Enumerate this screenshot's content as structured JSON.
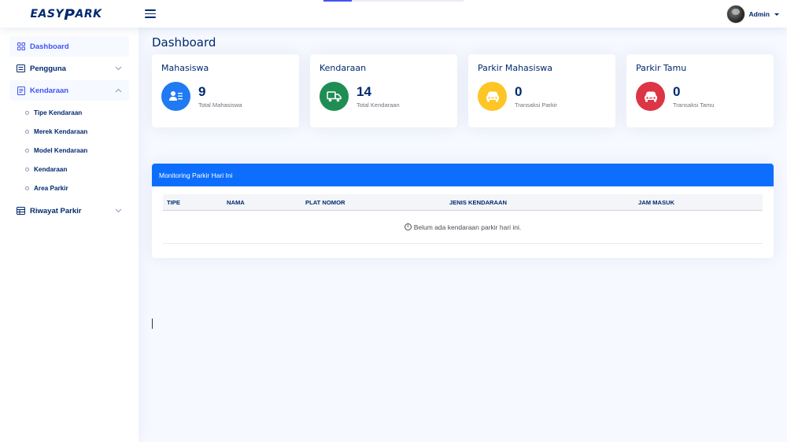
{
  "header": {
    "logo_left": "EASY ",
    "logo_p": "P",
    "logo_right": "ARK",
    "profile_name": "Admin"
  },
  "sidebar": {
    "items": [
      {
        "label": "Dashboard",
        "icon": "grid-icon",
        "state": "active"
      },
      {
        "label": "Pengguna",
        "icon": "menu-button-icon",
        "chevron": "chevron-down-icon"
      },
      {
        "label": "Kendaraan",
        "icon": "journal-icon",
        "chevron": "chevron-up-icon",
        "state": "expanded",
        "children": [
          "Tipe Kendaraan",
          "Merek Kendaraan",
          "Model Kendaraan",
          "Kendaraan",
          "Area Parkir"
        ]
      },
      {
        "label": "Riwayat Parkir",
        "icon": "table-icon",
        "chevron": "chevron-down-icon"
      }
    ]
  },
  "main": {
    "page_title": "Dashboard",
    "cards": [
      {
        "title": "Mahasiswa",
        "value": "9",
        "sub": "Total Mahasiswa",
        "icon": "people-list-icon",
        "color": "#1f7af3"
      },
      {
        "title": "Kendaraan",
        "value": "14",
        "sub": "Total Kendaraan",
        "icon": "truck-icon",
        "color": "#1e8e54"
      },
      {
        "title": "Parkir Mahasiswa",
        "value": "0",
        "sub": "Transaksi Parkir",
        "icon": "car-front-icon",
        "color": "#fdc526"
      },
      {
        "title": "Parkir Tamu",
        "value": "0",
        "sub": "Transaksi Tamu",
        "icon": "car-front-icon",
        "color": "#dc3545"
      }
    ],
    "monitoring": {
      "title": "Monitoring Parkir Hari Ini",
      "columns": [
        "TIPE",
        "NAMA",
        "PLAT NOMOR",
        "JENIS KENDARAAN",
        "JAM MASUK"
      ],
      "empty_message": "Belum ada kendaraan parkir hari ini."
    }
  },
  "colors": {
    "accent": "#4154f1",
    "navy": "#012970",
    "panel_header": "#0d6efd",
    "background": "#f6f9ff"
  }
}
